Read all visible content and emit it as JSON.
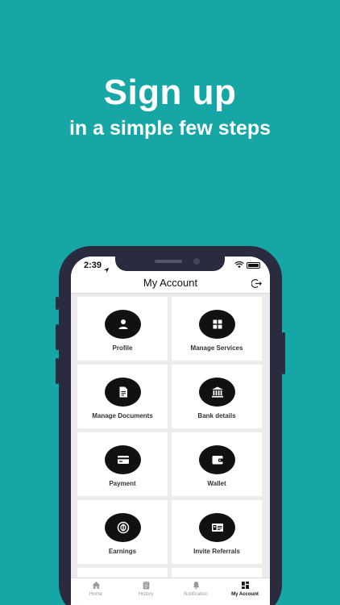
{
  "headline": {
    "title": "Sign up",
    "subtitle": "in a simple few steps"
  },
  "status": {
    "time": "2:39"
  },
  "appbar": {
    "title": "My Account",
    "logout_icon": "logout-icon"
  },
  "tiles": [
    {
      "label": "Profile",
      "icon": "person-icon"
    },
    {
      "label": "Manage Services",
      "icon": "grid-icon"
    },
    {
      "label": "Manage Documents",
      "icon": "document-icon"
    },
    {
      "label": "Bank details",
      "icon": "bank-icon"
    },
    {
      "label": "Payment",
      "icon": "credit-card-icon"
    },
    {
      "label": "Wallet",
      "icon": "wallet-icon"
    },
    {
      "label": "Earnings",
      "icon": "coin-icon"
    },
    {
      "label": "Invite Referrals",
      "icon": "referral-card-icon"
    }
  ],
  "tabs": [
    {
      "label": "Home",
      "icon": "home-icon"
    },
    {
      "label": "History",
      "icon": "history-icon"
    },
    {
      "label": "Notification",
      "icon": "bell-icon"
    },
    {
      "label": "My Account",
      "icon": "dashboard-icon",
      "active": true
    }
  ],
  "colors": {
    "background": "#16a6a6",
    "phone_frame": "#2b2b40",
    "icon_circle": "#111111"
  }
}
